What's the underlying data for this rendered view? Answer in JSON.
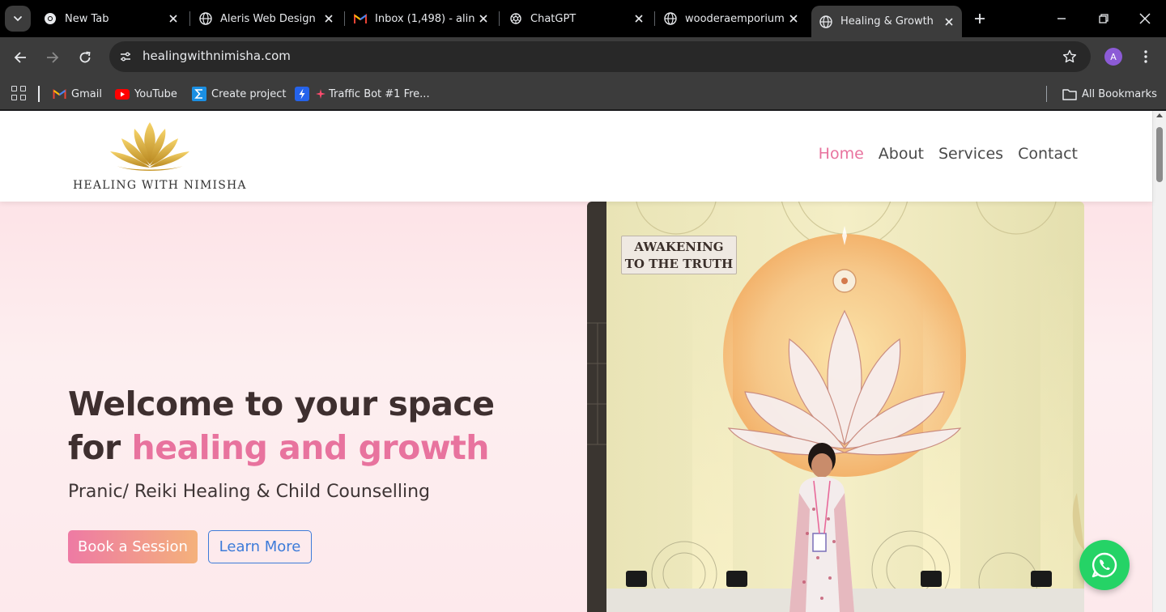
{
  "browser": {
    "tabs": [
      {
        "title": "New Tab",
        "icon": "chrome-icon"
      },
      {
        "title": "Aleris Web Design",
        "icon": "globe-icon"
      },
      {
        "title": "Inbox (1,498) - alin",
        "icon": "gmail-icon"
      },
      {
        "title": "ChatGPT",
        "icon": "openai-icon"
      },
      {
        "title": "wooderaemporium",
        "icon": "globe-icon"
      },
      {
        "title": "Healing & Growth",
        "icon": "globe-icon",
        "active": true
      }
    ],
    "url": "healingwithnimisha.com",
    "profile_initial": "A",
    "bookmarks": [
      {
        "label": "Gmail",
        "icon": "gmail-icon"
      },
      {
        "label": "YouTube",
        "icon": "youtube-icon"
      },
      {
        "label": "Create project",
        "icon": "sigma-icon"
      },
      {
        "label": "",
        "icon": "bolt-icon"
      },
      {
        "label": "Traffic Bot #1 Fre...",
        "icon": "spark-icon"
      }
    ],
    "all_bookmarks_label": "All Bookmarks"
  },
  "site": {
    "logo_text": "HEALING WITH NIMISHA",
    "nav": [
      {
        "label": "Home",
        "active": true
      },
      {
        "label": "About"
      },
      {
        "label": "Services"
      },
      {
        "label": "Contact"
      }
    ],
    "hero": {
      "title_line1": "Welcome to your space",
      "title_for": "for",
      "title_accent": "healing and growth",
      "subtitle": "Pranic/ Reiki Healing & Child Counselling",
      "primary_button": "Book a Session",
      "secondary_button": "Learn More",
      "photo_banner_line1": "AWAKENING",
      "photo_banner_line2": "TO THE TRUTH"
    }
  },
  "colors": {
    "accent_pink": "#e8739e",
    "nav_text": "#4a4a4a",
    "heading": "#3e2f2f",
    "learn_more_blue": "#3d7bd9",
    "whatsapp_green": "#25d366"
  }
}
